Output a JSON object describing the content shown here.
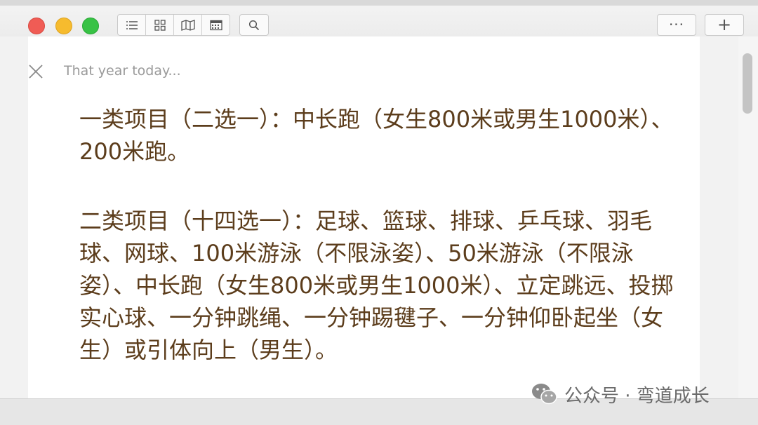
{
  "toolbar": {
    "view_buttons": [
      {
        "icon": "list-icon"
      },
      {
        "icon": "grid-icon"
      },
      {
        "icon": "map-icon"
      },
      {
        "icon": "calendar-icon"
      }
    ],
    "search_icon": "search-icon",
    "more_label": "···",
    "add_label": "+"
  },
  "editor": {
    "placeholder": "That year today...",
    "paragraphs": [
      "一类项目（二选一）：中长跑（女生800米或男生1000米）、200米跑。",
      "二类项目（十四选一）：足球、篮球、排球、乒乓球、羽毛球、网球、100米游泳（不限泳姿）、50米游泳（不限泳姿）、中长跑（女生800米或男生1000米）、立定跳远、投掷实心球、一分钟跳绳、一分钟踢毽子、一分钟仰卧起坐（女生）或引体向上（男生）。"
    ]
  },
  "watermark": {
    "text": "公众号 · 弯道成长",
    "icon": "wechat-icon"
  },
  "colors": {
    "text": "#5c3d1c",
    "placeholder": "#9a9a9a",
    "close": "#d8483f",
    "minimize": "#f6bb2e",
    "zoom": "#38c245"
  }
}
